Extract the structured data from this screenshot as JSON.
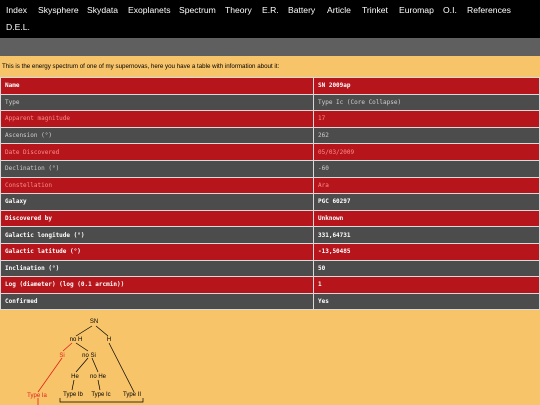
{
  "nav": {
    "row1": [
      "Index",
      "Skysphere",
      "Skydata",
      "Exoplanets",
      "Spectrum",
      "Theory",
      "E.R.",
      "Battery",
      "Article",
      "Trinket",
      "Euromap",
      "O.I.",
      "References"
    ],
    "row2": [
      "D.E.L."
    ]
  },
  "intro": "This is the energy spectrum of one of my supernovas, here you have a table with information about it:",
  "table": [
    {
      "key": "Name",
      "value": "SN 2009ap"
    },
    {
      "key": "Type",
      "value": "Type Ic (Core Collapse)"
    },
    {
      "key": "Apparent magnitude",
      "value": "17"
    },
    {
      "key": "Ascension (°)",
      "value": "262"
    },
    {
      "key": "Date Discovered",
      "value": "05/03/2009"
    },
    {
      "key": "Declination (°)",
      "value": "-60"
    },
    {
      "key": "Constellation",
      "value": "Ara"
    },
    {
      "key": "Galaxy",
      "value": "PGC 60297"
    },
    {
      "key": "Discovered by",
      "value": "Unknown"
    },
    {
      "key": "Galactic longitude (°)",
      "value": "331,64731"
    },
    {
      "key": "Galactic latitude (°)",
      "value": "-13,50485"
    },
    {
      "key": "Inclination (°)",
      "value": "50"
    },
    {
      "key": "Log (diameter) (log (0.1 arcmin))",
      "value": "1"
    },
    {
      "key": "Confirmed",
      "value": "Yes"
    }
  ],
  "diagram": {
    "root": "SN",
    "no_h": "no H",
    "h": "H",
    "si": "Si",
    "no_si": "no Si",
    "he": "He",
    "no_he": "no He",
    "type_ia": "Type Ia",
    "type_ib": "Type Ib",
    "type_ic": "Type Ic",
    "type_ii": "Type II"
  },
  "colors": {
    "background": "#f8c46a",
    "nav": "#000000",
    "band": "#5f5f5f",
    "row_red": "#b5151b",
    "row_gray": "#4c4c4c",
    "highlight": "#e0201c"
  }
}
